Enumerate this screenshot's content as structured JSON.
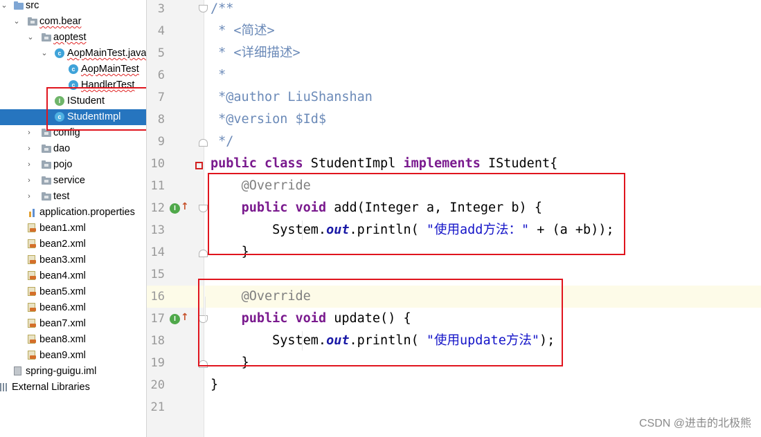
{
  "tree": {
    "items": [
      {
        "label": "src"
      },
      {
        "label": "com.bear"
      },
      {
        "label": "aoptest"
      },
      {
        "label": "AopMainTest.java"
      },
      {
        "label": "AopMainTest"
      },
      {
        "label": "HandlerTest"
      },
      {
        "label": "IStudent"
      },
      {
        "label": "StudentImpl"
      },
      {
        "label": "config"
      },
      {
        "label": "dao"
      },
      {
        "label": "pojo"
      },
      {
        "label": "service"
      },
      {
        "label": "test"
      },
      {
        "label": "application.properties"
      },
      {
        "label": "bean1.xml"
      },
      {
        "label": "bean2.xml"
      },
      {
        "label": "bean3.xml"
      },
      {
        "label": "bean4.xml"
      },
      {
        "label": "bean5.xml"
      },
      {
        "label": "bean6.xml"
      },
      {
        "label": "bean7.xml"
      },
      {
        "label": "bean8.xml"
      },
      {
        "label": "bean9.xml"
      },
      {
        "label": "spring-guigu.iml"
      },
      {
        "label": "External Libraries"
      }
    ],
    "selected": "StudentImpl"
  },
  "editor": {
    "line_numbers": [
      "3",
      "4",
      "5",
      "6",
      "7",
      "8",
      "9",
      "10",
      "11",
      "12",
      "13",
      "14",
      "15",
      "16",
      "17",
      "18",
      "19",
      "20",
      "21"
    ],
    "highlighted_line": "16",
    "gutter_icon_letter": "I",
    "code": {
      "l3": "/**",
      "l4": " * <简述>",
      "l5": " * <详细描述>",
      "l6": " *",
      "l7_tag": "@author",
      "l7_val": " LiuShanshan",
      "l8_tag": "@version",
      "l8_val": " $Id$",
      "l9": " */",
      "l10_kw1": "public",
      "l10_kw2": "class",
      "l10_name": " StudentImpl ",
      "l10_kw3": "implements",
      "l10_rest": " IStudent{",
      "l11": "@Override",
      "l12_kw1": "public",
      "l12_kw2": "void",
      "l12_rest": " add(Integer a, Integer b) {",
      "l13_a": "System.",
      "l13_field": "out",
      "l13_b": ".println( ",
      "l13_str": "\"使用add方法：\"",
      "l13_c": " + (a +b));",
      "l14": "}",
      "l16": "@Override",
      "l17_kw1": "public",
      "l17_kw2": "void",
      "l17_rest": " update() {",
      "l18_a": "System.",
      "l18_field": "out",
      "l18_b": ".println( ",
      "l18_str": "\"使用update方法\"",
      "l18_c": ");",
      "l19": "}",
      "l20": "}"
    }
  },
  "watermark": "CSDN @进击的北极熊"
}
